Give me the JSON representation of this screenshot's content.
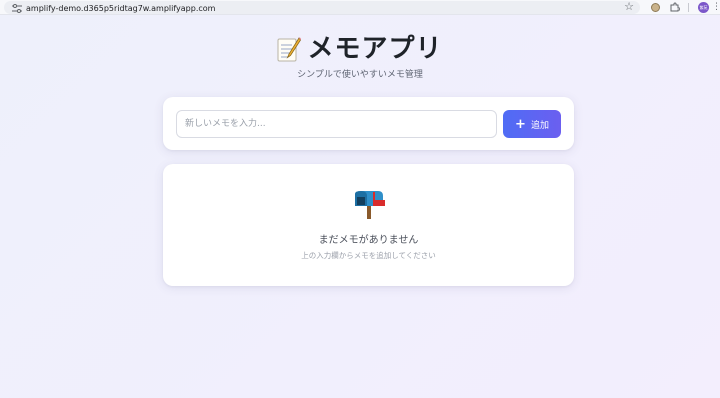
{
  "browser": {
    "url": "amplify-demo.d365p5ridtag7w.amplifyapp.com",
    "profile_initials": "紫苑"
  },
  "header": {
    "emoji": "memo-icon",
    "title": "メモアプリ",
    "subtitle": "シンプルで使いやすいメモ管理"
  },
  "input": {
    "placeholder": "新しいメモを入力...",
    "value": ""
  },
  "add_button": {
    "icon": "plus-icon",
    "label": "追加"
  },
  "empty_state": {
    "icon": "mailbox-icon",
    "title": "まだメモがありません",
    "hint": "上の入力欄からメモを追加してください"
  },
  "colors": {
    "accent_start": "#4f6cf5",
    "accent_end": "#6b5ff0",
    "background": "#eef0fb"
  }
}
